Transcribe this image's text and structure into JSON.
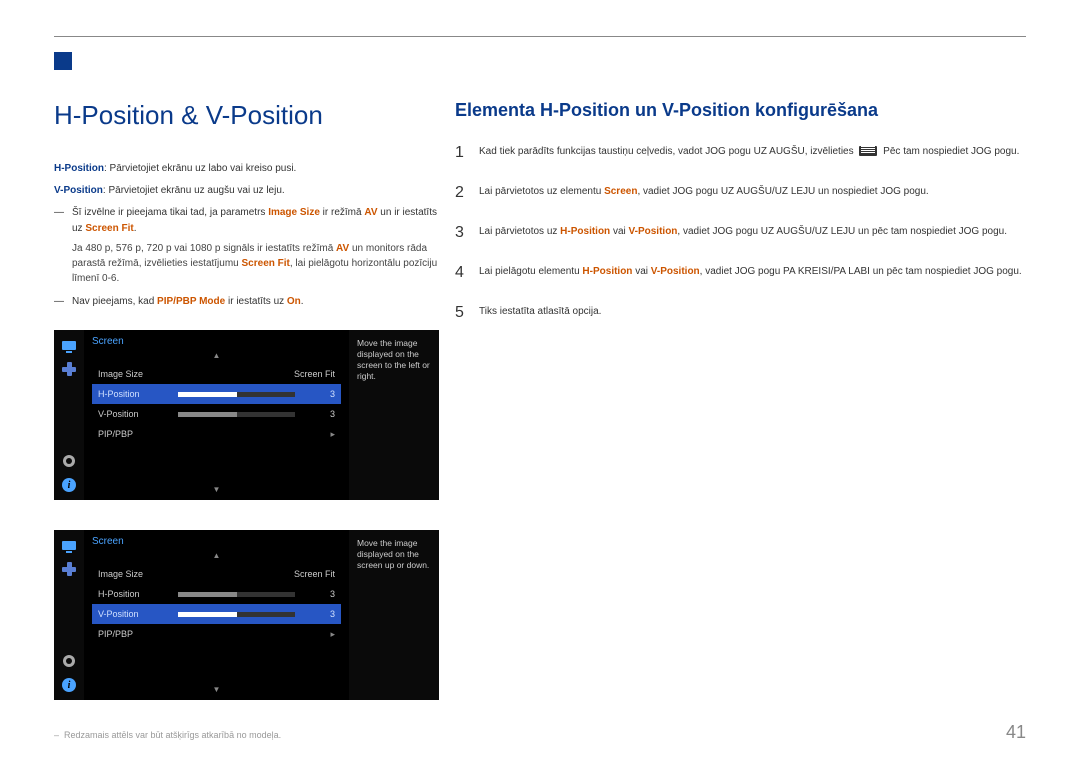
{
  "page_number": "41",
  "left": {
    "heading": "H-Position & V-Position",
    "h_desc_label": "H-Position",
    "h_desc_text": ": Pārvietojiet ekrānu uz labo vai kreiso pusi.",
    "v_desc_label": "V-Position",
    "v_desc_text": ": Pārvietojiet ekrānu uz augšu vai uz leju.",
    "note1_a": "Šī izvēlne ir pieejama tikai tad, ja parametrs ",
    "note1_b": "Image Size",
    "note1_c": " ir režīmā ",
    "note1_d": "AV",
    "note1_e": " un ir iestatīts uz ",
    "note1_f": "Screen Fit",
    "note1_g": ".",
    "indent_a": "Ja 480 p, 576 p, 720 p vai 1080 p signāls ir iestatīts režīmā ",
    "indent_b": "AV",
    "indent_c": " un monitors rāda parastā režīmā, izvēlieties iestatījumu ",
    "indent_d": "Screen Fit",
    "indent_e": ", lai pielāgotu horizontālu pozīciju līmenī 0-6.",
    "note2_a": "Nav pieejams, kad ",
    "note2_b": "PIP/PBP Mode",
    "note2_c": " ir iestatīts uz ",
    "note2_d": "On",
    "note2_e": ".",
    "footnote": "Redzamais attēls var būt atšķirīgs atkarībā no modeļa."
  },
  "osd1": {
    "title": "Screen",
    "r1_label": "Image Size",
    "r1_val": "Screen Fit",
    "r2_label": "H-Position",
    "r2_val": "3",
    "r3_label": "V-Position",
    "r3_val": "3",
    "r4_label": "PIP/PBP",
    "tip": "Move the image displayed on the screen to the left or right."
  },
  "osd2": {
    "title": "Screen",
    "r1_label": "Image Size",
    "r1_val": "Screen Fit",
    "r2_label": "H-Position",
    "r2_val": "3",
    "r3_label": "V-Position",
    "r3_val": "3",
    "r4_label": "PIP/PBP",
    "tip": "Move the image displayed on the screen up or down."
  },
  "right": {
    "heading": "Elementa H-Position un V-Position konfigurēšana",
    "s1_a": "Kad tiek parādīts funkcijas taustiņu ceļvedis, vadot JOG pogu UZ AUGŠU, izvēlieties ",
    "s1_b": " Pēc tam nospiediet JOG pogu.",
    "s2_a": "Lai pārvietotos uz elementu ",
    "s2_b": "Screen",
    "s2_c": ", vadiet JOG pogu UZ AUGŠU/UZ LEJU un nospiediet JOG pogu.",
    "s3_a": "Lai pārvietotos uz ",
    "s3_b": "H-Position",
    "s3_c": " vai ",
    "s3_d": "V-Position",
    "s3_e": ", vadiet JOG pogu UZ AUGŠU/UZ LEJU un pēc tam nospiediet JOG pogu.",
    "s4_a": "Lai pielāgotu elementu ",
    "s4_b": "H-Position",
    "s4_c": " vai ",
    "s4_d": "V-Position",
    "s4_e": ", vadiet JOG pogu PA KREISI/PA LABI un pēc tam nospiediet JOG pogu.",
    "s5": "Tiks iestatīta atlasītā opcija."
  },
  "nums": {
    "n1": "1",
    "n2": "2",
    "n3": "3",
    "n4": "4",
    "n5": "5"
  }
}
